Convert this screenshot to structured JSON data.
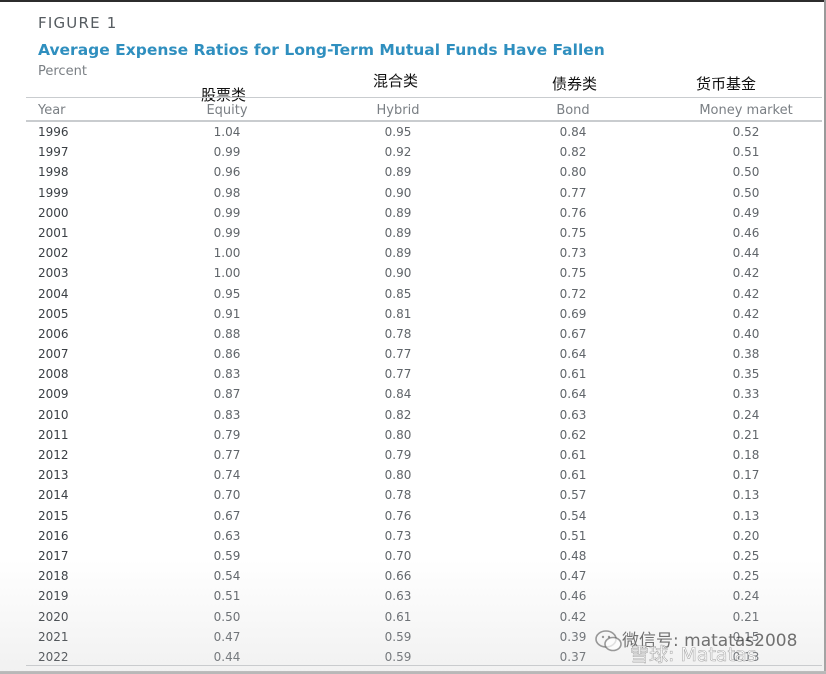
{
  "figure": {
    "label": "FIGURE 1",
    "title": "Average Expense Ratios for Long-Term Mutual Funds Have Fallen",
    "unit": "Percent"
  },
  "annotations": {
    "equity_cn": "股票类",
    "hybrid_cn": "混合类",
    "bond_cn": "债券类",
    "money_cn": "货币基金"
  },
  "table": {
    "headers": [
      "Year",
      "Equity",
      "Hybrid",
      "Bond",
      "Money market"
    ],
    "rows": [
      [
        "1996",
        "1.04",
        "0.95",
        "0.84",
        "0.52"
      ],
      [
        "1997",
        "0.99",
        "0.92",
        "0.82",
        "0.51"
      ],
      [
        "1998",
        "0.96",
        "0.89",
        "0.80",
        "0.50"
      ],
      [
        "1999",
        "0.98",
        "0.90",
        "0.77",
        "0.50"
      ],
      [
        "2000",
        "0.99",
        "0.89",
        "0.76",
        "0.49"
      ],
      [
        "2001",
        "0.99",
        "0.89",
        "0.75",
        "0.46"
      ],
      [
        "2002",
        "1.00",
        "0.89",
        "0.73",
        "0.44"
      ],
      [
        "2003",
        "1.00",
        "0.90",
        "0.75",
        "0.42"
      ],
      [
        "2004",
        "0.95",
        "0.85",
        "0.72",
        "0.42"
      ],
      [
        "2005",
        "0.91",
        "0.81",
        "0.69",
        "0.42"
      ],
      [
        "2006",
        "0.88",
        "0.78",
        "0.67",
        "0.40"
      ],
      [
        "2007",
        "0.86",
        "0.77",
        "0.64",
        "0.38"
      ],
      [
        "2008",
        "0.83",
        "0.77",
        "0.61",
        "0.35"
      ],
      [
        "2009",
        "0.87",
        "0.84",
        "0.64",
        "0.33"
      ],
      [
        "2010",
        "0.83",
        "0.82",
        "0.63",
        "0.24"
      ],
      [
        "2011",
        "0.79",
        "0.80",
        "0.62",
        "0.21"
      ],
      [
        "2012",
        "0.77",
        "0.79",
        "0.61",
        "0.18"
      ],
      [
        "2013",
        "0.74",
        "0.80",
        "0.61",
        "0.17"
      ],
      [
        "2014",
        "0.70",
        "0.78",
        "0.57",
        "0.13"
      ],
      [
        "2015",
        "0.67",
        "0.76",
        "0.54",
        "0.13"
      ],
      [
        "2016",
        "0.63",
        "0.73",
        "0.51",
        "0.20"
      ],
      [
        "2017",
        "0.59",
        "0.70",
        "0.48",
        "0.25"
      ],
      [
        "2018",
        "0.54",
        "0.66",
        "0.47",
        "0.25"
      ],
      [
        "2019",
        "0.51",
        "0.63",
        "0.46",
        "0.24"
      ],
      [
        "2020",
        "0.50",
        "0.61",
        "0.42",
        "0.21"
      ],
      [
        "2021",
        "0.47",
        "0.59",
        "0.39",
        "0.15"
      ],
      [
        "2022",
        "0.44",
        "0.59",
        "0.37",
        "0.13"
      ]
    ]
  },
  "watermark": {
    "line1": "微信号: matatas2008",
    "line2": "雪球: Matatas"
  },
  "colors": {
    "title": "#2f8fbf",
    "text": "#60656a",
    "rule": "#c9cccf"
  }
}
